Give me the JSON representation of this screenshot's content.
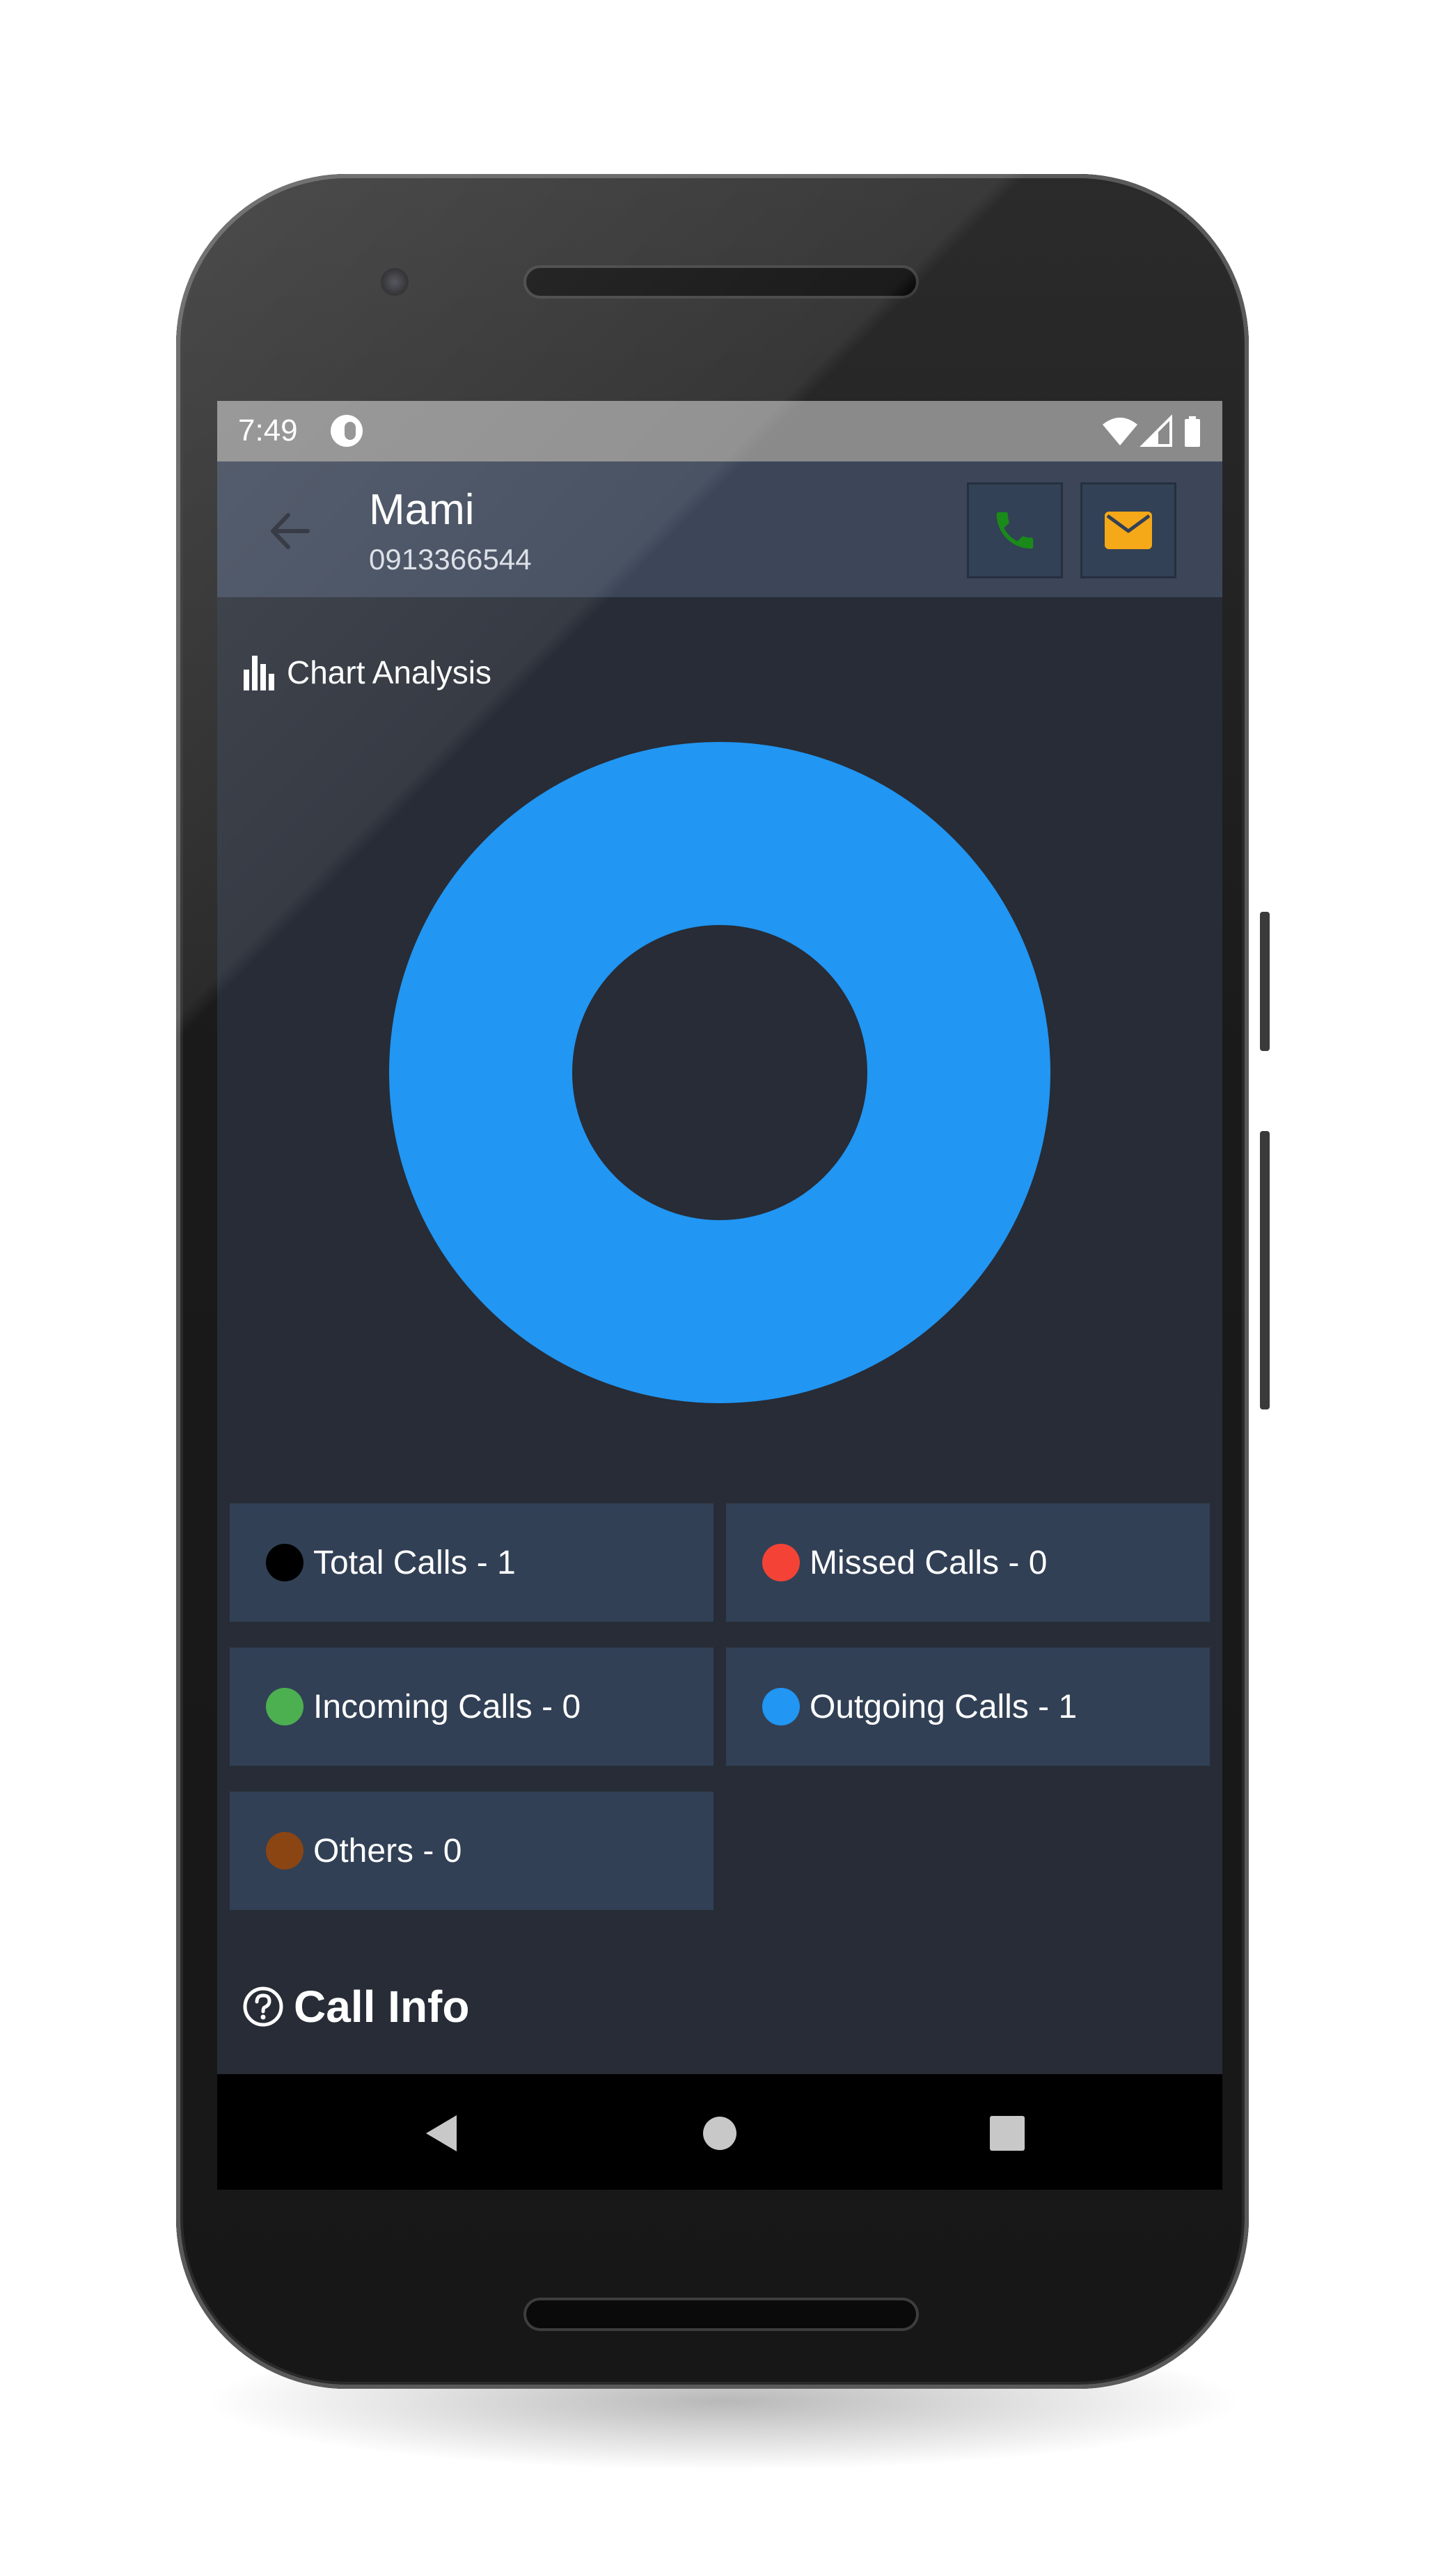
{
  "status_bar": {
    "time": "7:49",
    "icons": [
      "app-notification-icon",
      "wifi-icon",
      "cell-signal-icon",
      "battery-icon"
    ]
  },
  "app_bar": {
    "back_icon": "arrow-back-icon",
    "contact_name": "Mami",
    "contact_number": "0913366544",
    "call_icon": "phone-icon",
    "message_icon": "mail-icon",
    "call_icon_color": "#1a8a1a",
    "message_icon_color": "#f5a818"
  },
  "chart_section": {
    "title": "Chart Analysis",
    "icon": "bar-chart-icon"
  },
  "chart_data": {
    "type": "pie",
    "donut": true,
    "categories": [
      "Total Calls",
      "Missed Calls",
      "Incoming Calls",
      "Outgoing Calls",
      "Others"
    ],
    "values": [
      1,
      0,
      0,
      1,
      0
    ],
    "slices": [
      {
        "label": "Outgoing Calls",
        "value": 1,
        "color": "#2196f3"
      }
    ]
  },
  "legend": [
    {
      "label": "Total Calls - 1",
      "color": "#000000"
    },
    {
      "label": "Missed Calls - 0",
      "color": "#f44336"
    },
    {
      "label": "Incoming Calls - 0",
      "color": "#4caf50"
    },
    {
      "label": "Outgoing Calls - 1",
      "color": "#2196f3"
    },
    {
      "label": "Others - 0",
      "color": "#8b4513"
    }
  ],
  "call_info": {
    "title": "Call Info",
    "icon": "help-circle-icon"
  },
  "nav_bar": {
    "icons": [
      "back-triangle-icon",
      "home-circle-icon",
      "recents-square-icon"
    ]
  },
  "colors": {
    "screen_bg": "#272c36",
    "app_bar_bg": "#3c4658",
    "card_bg": "#314055",
    "accent_blue": "#2196f3"
  }
}
